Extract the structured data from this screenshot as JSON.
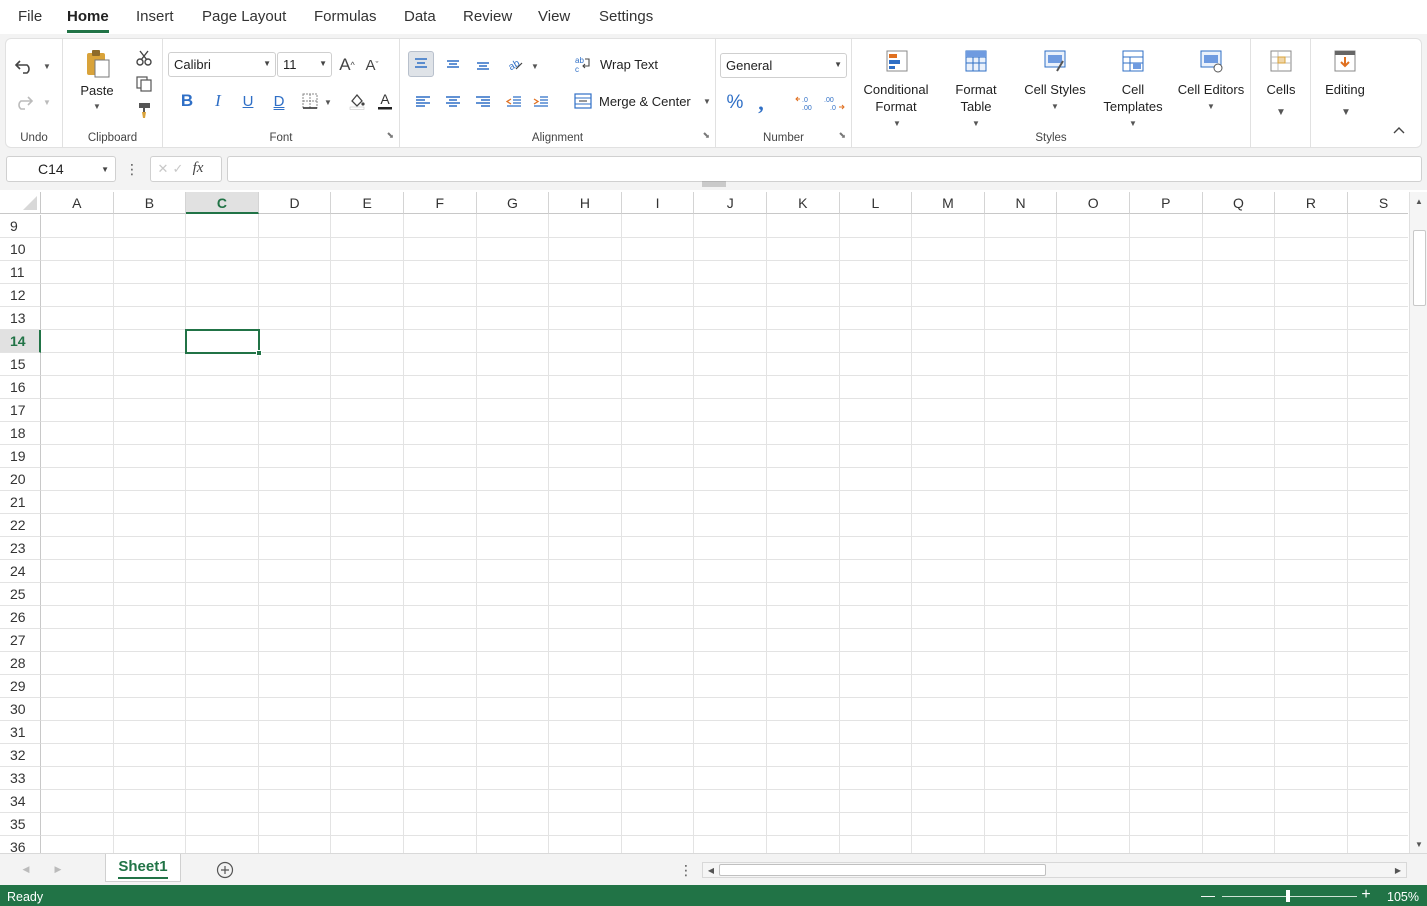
{
  "menu": {
    "tabs": [
      "File",
      "Home",
      "Insert",
      "Page Layout",
      "Formulas",
      "Data",
      "Review",
      "View",
      "Settings"
    ],
    "active": "Home"
  },
  "ribbon": {
    "undo": {
      "label": "Undo"
    },
    "clipboard": {
      "label": "Clipboard",
      "paste_label": "Paste"
    },
    "font": {
      "label": "Font",
      "family": "Calibri",
      "size": "11"
    },
    "alignment": {
      "label": "Alignment",
      "wrap_text": "Wrap Text",
      "merge_center": "Merge & Center"
    },
    "number": {
      "label": "Number",
      "format": "General"
    },
    "styles": {
      "label": "Styles",
      "conditional_format": [
        "Conditional",
        "Format"
      ],
      "format_table": [
        "Format",
        "Table"
      ],
      "cell_styles": "Cell Styles",
      "cell_templates": [
        "Cell",
        "Templates"
      ],
      "cell_editors": "Cell Editors"
    },
    "cells": {
      "label": "Cells"
    },
    "editing": {
      "label": "Editing"
    }
  },
  "formula_bar": {
    "name_box": "C14",
    "fx_label": "fx",
    "value": ""
  },
  "grid": {
    "columns": [
      "A",
      "B",
      "C",
      "D",
      "E",
      "F",
      "G",
      "H",
      "I",
      "J",
      "K",
      "L",
      "M",
      "N",
      "O",
      "P",
      "Q",
      "R",
      "S"
    ],
    "rows": [
      "9",
      "10",
      "11",
      "12",
      "13",
      "14",
      "15",
      "16",
      "17",
      "18",
      "19",
      "20",
      "21",
      "22",
      "23",
      "24",
      "25",
      "26",
      "27",
      "28",
      "29",
      "30",
      "31",
      "32",
      "33",
      "34",
      "35",
      "36"
    ],
    "selected_column": "C",
    "selected_row": "14"
  },
  "sheets": {
    "tabs": [
      "Sheet1"
    ],
    "active": "Sheet1"
  },
  "status": {
    "text": "Ready",
    "zoom": "105%"
  },
  "colors": {
    "accent": "#217346",
    "ribbon_bg": "#f3f3f3",
    "gridline": "#e3e3e3"
  }
}
